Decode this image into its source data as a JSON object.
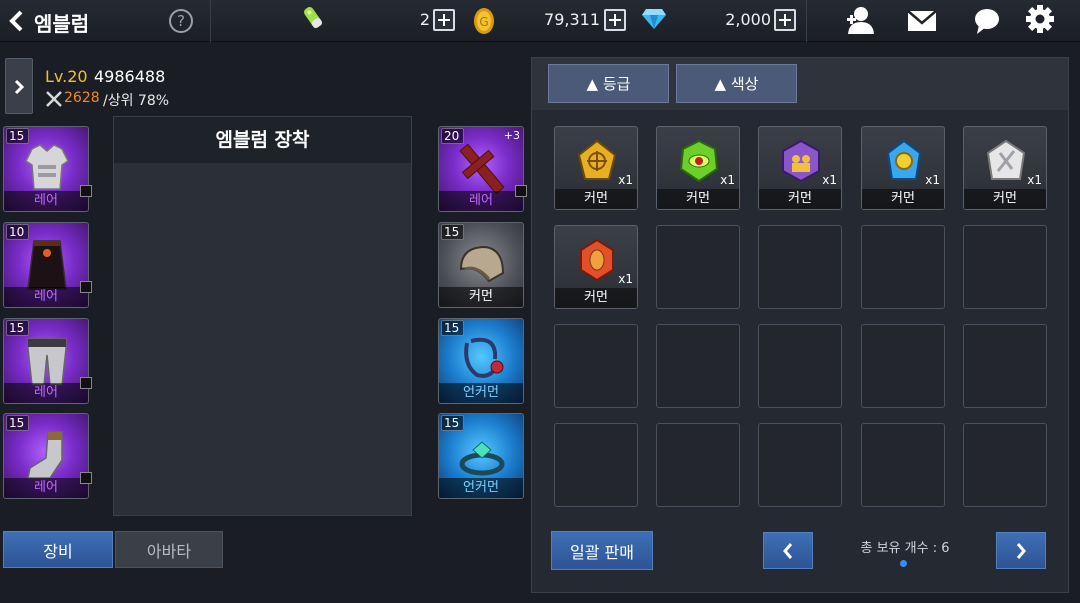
{
  "header": {
    "title": "엠블럼",
    "stamina": "2",
    "gold": "79,311",
    "gems": "2,000"
  },
  "character": {
    "level": "Lv.20",
    "id": "4986488",
    "power": "2628",
    "rank": "/상위 78%"
  },
  "panel": {
    "title": "엠블럼 장착"
  },
  "left_slots": [
    {
      "level": "15",
      "grade": "레어"
    },
    {
      "level": "10",
      "grade": "레어"
    },
    {
      "level": "15",
      "grade": "레어"
    },
    {
      "level": "15",
      "grade": "레어"
    }
  ],
  "right_slots": [
    {
      "level": "20",
      "grade": "레어",
      "enhance": "+3"
    },
    {
      "level": "15",
      "grade": "커먼"
    },
    {
      "level": "15",
      "grade": "언커먼"
    },
    {
      "level": "15",
      "grade": "언커먼"
    }
  ],
  "tabs": {
    "equip": "장비",
    "avatar": "아바타"
  },
  "filters": {
    "grade": "▲ 등급",
    "color": "▲ 색상"
  },
  "inventory": [
    {
      "name": "커먼",
      "count": "x1",
      "color": "#e8b020"
    },
    {
      "name": "커먼",
      "count": "x1",
      "color": "#6ccf2a"
    },
    {
      "name": "커먼",
      "count": "x1",
      "color": "#8a56c8"
    },
    {
      "name": "커먼",
      "count": "x1",
      "color": "#3aa6ee"
    },
    {
      "name": "커먼",
      "count": "x1",
      "color": "#e6e6e6"
    },
    {
      "name": "커먼",
      "count": "x1",
      "color": "#e2502a"
    }
  ],
  "footer": {
    "sell_all": "일괄 판매",
    "total_label": "총 보유 개수 : 6"
  }
}
